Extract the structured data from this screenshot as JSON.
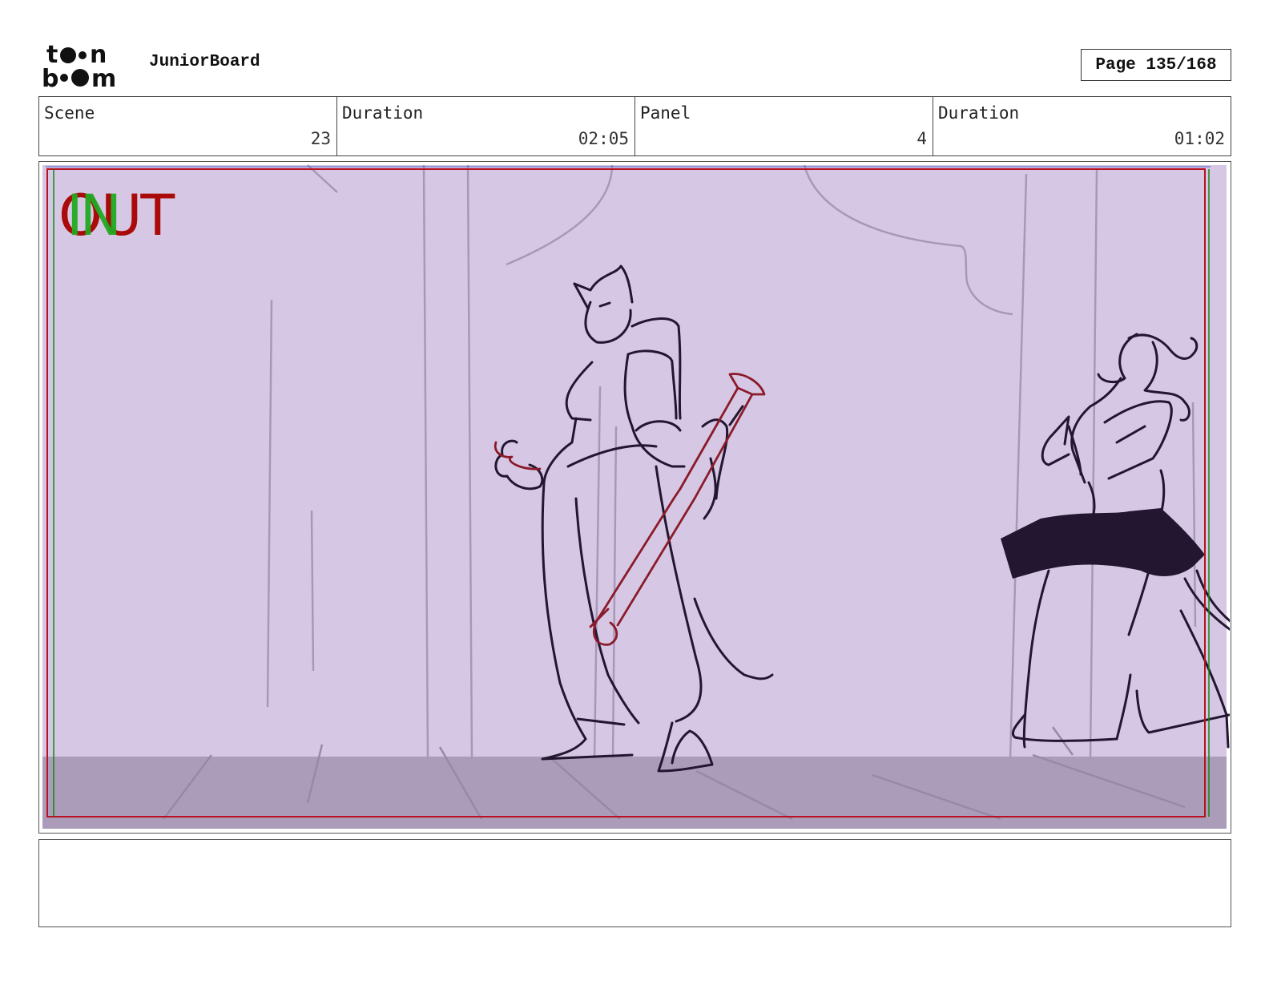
{
  "header": {
    "logo_text": "toon boom",
    "app_title": "JuniorBoard",
    "page_label": "Page 135/168"
  },
  "info": {
    "scene_label": "Scene",
    "scene_value": "23",
    "scene_duration_label": "Duration",
    "scene_duration_value": "02:05",
    "panel_label": "Panel",
    "panel_value": "4",
    "panel_duration_label": "Duration",
    "panel_duration_value": "01:02"
  },
  "panel": {
    "in_marker": "IN",
    "out_marker": "OUT",
    "colors": {
      "background": "#d6c8e4",
      "floor": "#ab9dba",
      "ink": "#221630",
      "red_ink": "#8b1a2a",
      "in_green": "#22aa22",
      "out_red": "#aa0a0a"
    }
  },
  "notes": {
    "text": ""
  }
}
